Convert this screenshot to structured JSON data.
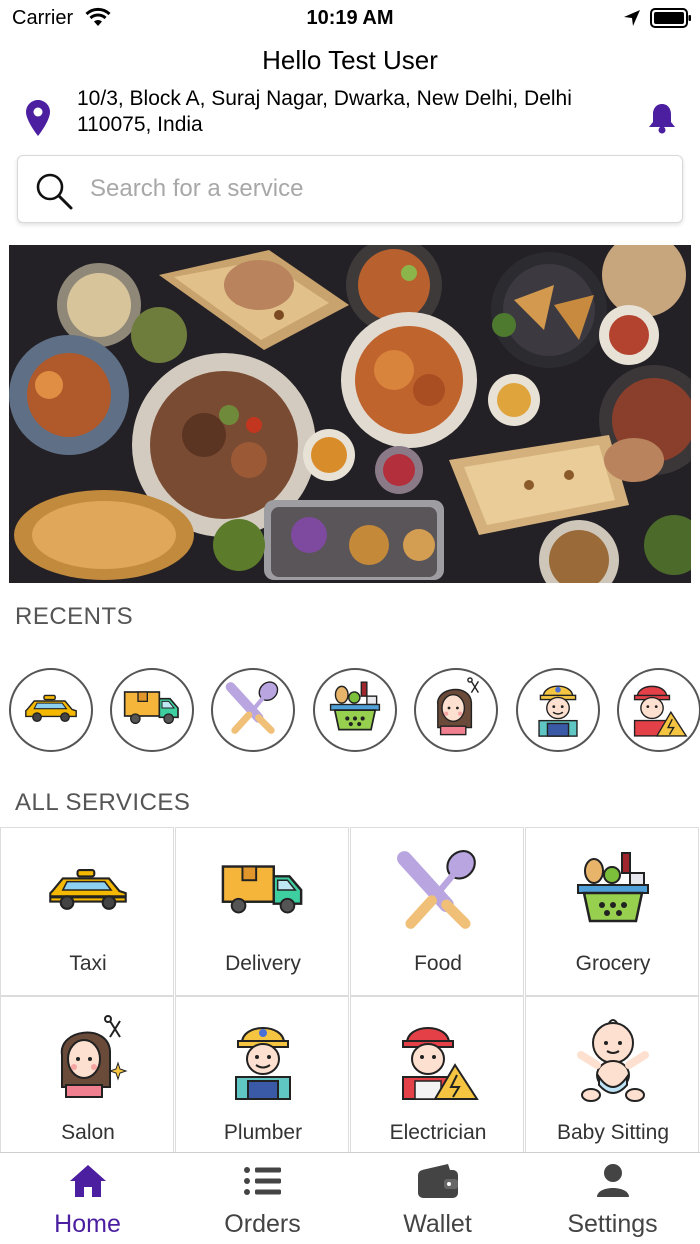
{
  "status_bar": {
    "carrier": "Carrier",
    "time": "10:19 AM"
  },
  "header": {
    "greeting": "Hello Test User",
    "address": "10/3, Block A, Suraj Nagar, Dwarka, New Delhi, Delhi 110075, India"
  },
  "search": {
    "placeholder": "Search for a service",
    "value": ""
  },
  "recents": {
    "title": "RECENTS",
    "items": [
      {
        "icon": "taxi-icon"
      },
      {
        "icon": "delivery-truck-icon"
      },
      {
        "icon": "food-utensils-icon"
      },
      {
        "icon": "grocery-basket-icon"
      },
      {
        "icon": "salon-icon"
      },
      {
        "icon": "plumber-icon"
      },
      {
        "icon": "electrician-icon"
      }
    ]
  },
  "services": {
    "title": "ALL SERVICES",
    "items": [
      {
        "label": "Taxi",
        "icon": "taxi-icon"
      },
      {
        "label": "Delivery",
        "icon": "delivery-truck-icon"
      },
      {
        "label": "Food",
        "icon": "food-utensils-icon"
      },
      {
        "label": "Grocery",
        "icon": "grocery-basket-icon"
      },
      {
        "label": "Salon",
        "icon": "salon-icon"
      },
      {
        "label": "Plumber",
        "icon": "plumber-icon"
      },
      {
        "label": "Electrician",
        "icon": "electrician-icon"
      },
      {
        "label": "Baby Sitting",
        "icon": "baby-icon"
      }
    ]
  },
  "tab_bar": {
    "active": "Home",
    "tabs": [
      {
        "label": "Home",
        "icon": "home-icon"
      },
      {
        "label": "Orders",
        "icon": "list-icon"
      },
      {
        "label": "Wallet",
        "icon": "wallet-icon"
      },
      {
        "label": "Settings",
        "icon": "person-icon"
      }
    ]
  },
  "colors": {
    "accent": "#4b1fa0",
    "text": "#111111",
    "muted": "#555555",
    "border": "#dcdcdc"
  }
}
